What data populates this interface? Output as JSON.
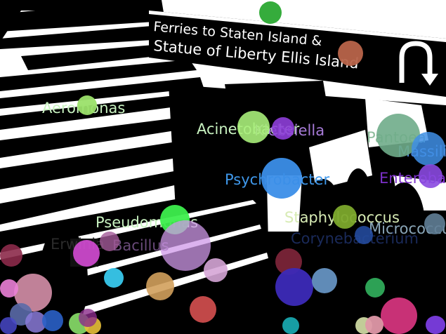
{
  "sign": {
    "line1": "Ferries to Staten Island &",
    "line2": "Statue of Liberty Ellis Island",
    "arrow_icon": "u-turn-arrow-icon"
  },
  "labels": [
    {
      "id": "aeromonas",
      "text": "Aeromonas",
      "color": "#c9f3c1"
    },
    {
      "id": "acinetobacter",
      "text": "Acinetobacter",
      "color": "#c9f3c1"
    },
    {
      "id": "klebsiella",
      "text": "Klebsiella",
      "color": "#a77bd8"
    },
    {
      "id": "pantoea",
      "text": "Pantoea",
      "color": "#8cbc9b"
    },
    {
      "id": "massilia",
      "text": "Massilia",
      "color": "#4a86d8"
    },
    {
      "id": "psychrobacter",
      "text": "Psychrobacter",
      "color": "#3f98eb"
    },
    {
      "id": "enterobacter",
      "text": "Enterobacter",
      "color": "#7b2fc8"
    },
    {
      "id": "pseudomonas",
      "text": "Pseudomonas",
      "color": "#c9f3c1"
    },
    {
      "id": "staphylococcus",
      "text": "Staphylococcus",
      "color": "#d7ebb4"
    },
    {
      "id": "micrococcus",
      "text": "Micrococcus",
      "color": "#8aa6b8"
    },
    {
      "id": "erwinia",
      "text": "Erwinia",
      "color": "#2b2b2b"
    },
    {
      "id": "bacillus",
      "text": "Bacillus",
      "color": "#6a4a7a"
    },
    {
      "id": "corynebacterium",
      "text": "Corynebacterium",
      "color": "#1a2a5a"
    }
  ],
  "bubbles": [
    {
      "color": "#2aa832"
    },
    {
      "color": "#b8644a"
    },
    {
      "color": "#9be06a"
    },
    {
      "color": "#a9ee7a"
    },
    {
      "color": "#8e3ed9"
    },
    {
      "color": "#6fac8a"
    },
    {
      "color": "#3f8fe6"
    },
    {
      "color": "#8a49e0"
    },
    {
      "color": "#3b8ee8"
    },
    {
      "color": "#3dee4d"
    },
    {
      "color": "#7ca82c"
    },
    {
      "color": "#234a9c"
    },
    {
      "color": "#617e96"
    },
    {
      "color": "#cf98e8"
    },
    {
      "color": "#e04fe0"
    },
    {
      "color": "#a25a98"
    },
    {
      "color": "#8c2a4a"
    },
    {
      "color": "#d5a5d6"
    },
    {
      "color": "#cb8ac0"
    },
    {
      "color": "#38c8ec"
    },
    {
      "color": "#d2a05c"
    },
    {
      "color": "#7a2438"
    },
    {
      "color": "#3c2ab8"
    },
    {
      "color": "#6a9acb"
    },
    {
      "color": "#d58fa8"
    },
    {
      "color": "#ea7fd6"
    },
    {
      "color": "#d65050"
    },
    {
      "color": "#2faa5a"
    },
    {
      "color": "#d3347c"
    },
    {
      "color": "#18a5ad"
    },
    {
      "color": "#ccd7a0"
    },
    {
      "color": "#df98a8"
    },
    {
      "color": "#7b3de0"
    },
    {
      "color": "#5a6aa8"
    },
    {
      "color": "#8a7ad8"
    },
    {
      "color": "#2a60c8"
    },
    {
      "color": "#8ae06a"
    },
    {
      "color": "#e8c038"
    },
    {
      "color": "#8a2a8a"
    },
    {
      "color": "#4848c8"
    }
  ]
}
